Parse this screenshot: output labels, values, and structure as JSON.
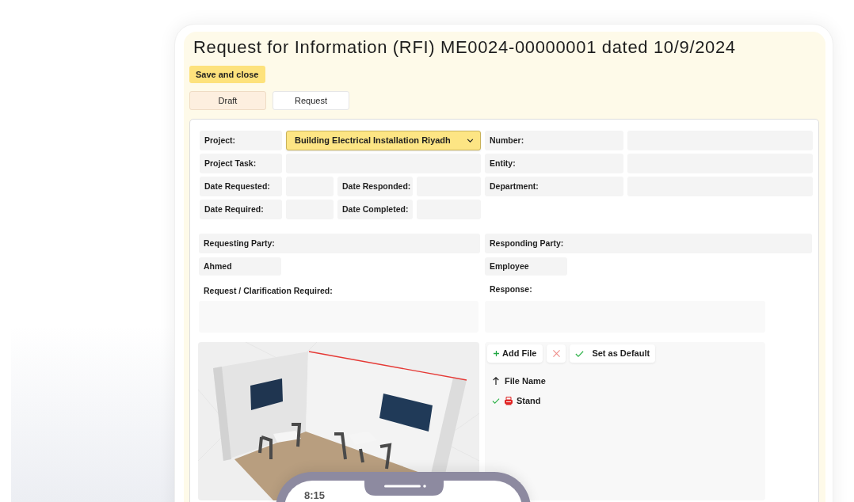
{
  "title": "Request for Information (RFI) ME0024-00000001 dated 10/9/2024",
  "actions": [
    {
      "label": "Save and close"
    }
  ],
  "tabs": [
    {
      "label": "Draft",
      "selected": true
    },
    {
      "label": "Request",
      "selected": false
    }
  ],
  "form": {
    "left_rows": [
      {
        "kind": "dropdown",
        "label": "Project:",
        "value": "Building Electrical Installation Riyadh"
      },
      {
        "kind": "text",
        "label": "Project Task:"
      },
      {
        "kind": "dates",
        "label": "Date Requested:",
        "second_label": "Date Responded:"
      },
      {
        "kind": "dates",
        "label": "Date Required:",
        "second_label": "Date Completed:"
      }
    ],
    "right_rows": [
      {
        "label": "Number:"
      },
      {
        "label": "Entity:"
      },
      {
        "label": "Department:"
      }
    ],
    "requesting_party": {
      "label": "Requesting Party:",
      "value": "Ahmed"
    },
    "responding_party": {
      "label": "Responding Party:",
      "value": "Employee"
    },
    "request_text": {
      "label": "Request / Clarification Required:"
    },
    "response_text": {
      "label": "Response:"
    }
  },
  "attachments": {
    "toolbar": [
      {
        "kind": "add",
        "label": "Add File"
      },
      {
        "kind": "delete"
      },
      {
        "kind": "default",
        "label": "Set as Default"
      }
    ],
    "column_header": {
      "label": "File Name",
      "sorted": true
    },
    "files": [
      {
        "name": "Stand",
        "default": true
      }
    ]
  },
  "phone": {
    "time": "8:15"
  }
}
